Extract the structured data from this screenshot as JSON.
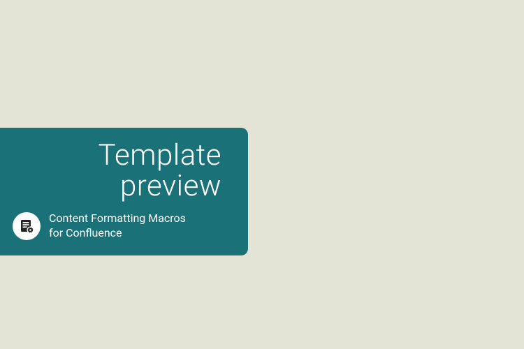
{
  "card": {
    "title_line1": "Template",
    "title_line2": "preview",
    "subtitle_line1": "Content Formatting Macros",
    "subtitle_line2": "for Confluence"
  },
  "colors": {
    "background": "#e3e3d6",
    "card_bg": "#1a7278",
    "text": "#ffffff",
    "icon_bg": "#ffffff",
    "icon_fg": "#222222"
  }
}
